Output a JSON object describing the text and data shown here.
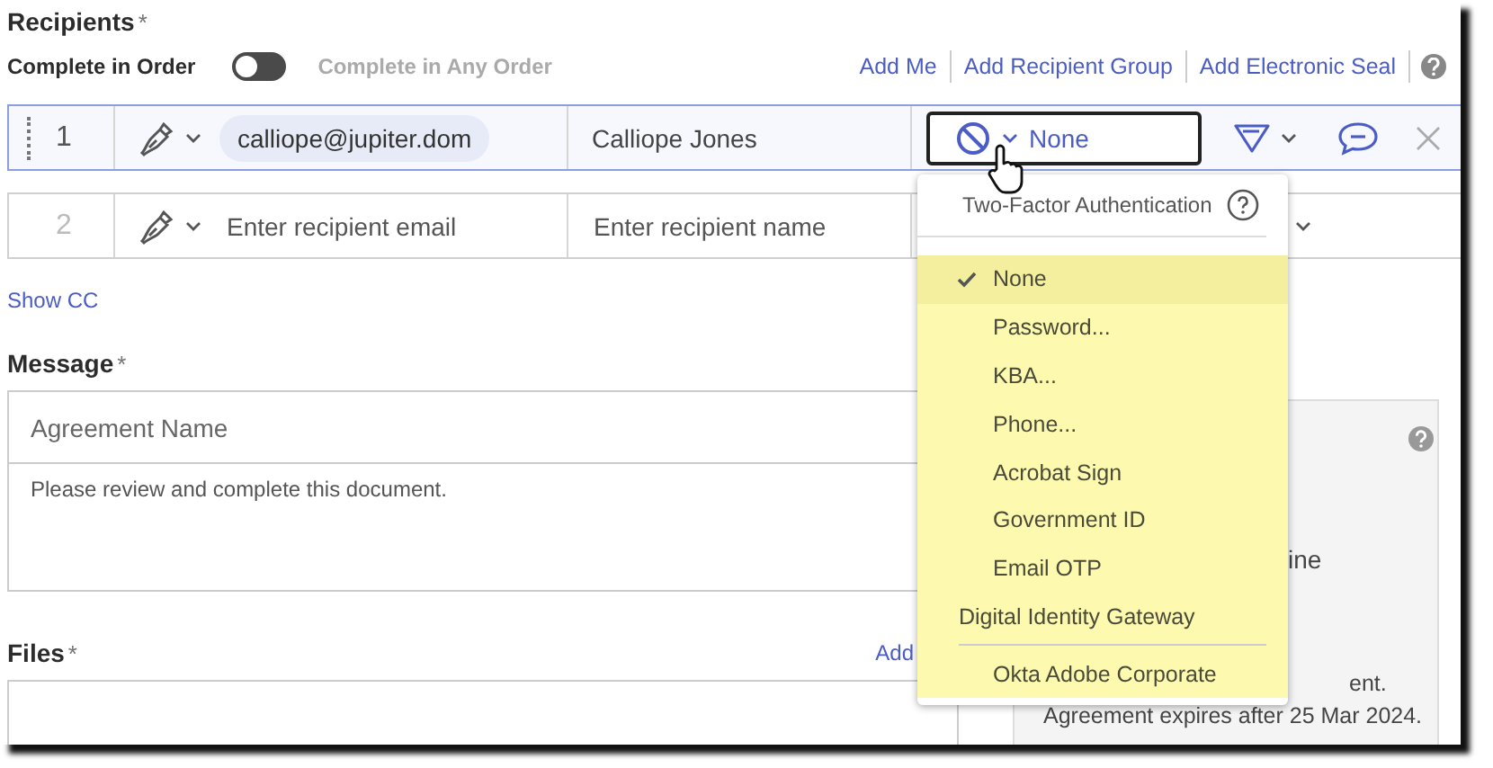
{
  "section_title": "Recipients",
  "required_mark": "*",
  "order_toggle": {
    "label_left": "Complete in Order",
    "on": false,
    "label_right": "Complete in Any Order"
  },
  "actions": [
    "Add Me",
    "Add Recipient Group",
    "Add Electronic Seal"
  ],
  "recipients": [
    {
      "number": "1",
      "email": "calliope@jupiter.dom",
      "name": "Calliope Jones",
      "active": true,
      "auth": "None"
    },
    {
      "number": "2",
      "email_placeholder": "Enter recipient email",
      "name_placeholder": "Enter recipient name",
      "active": false
    }
  ],
  "show_cc": "Show CC",
  "message": {
    "title": "Message",
    "required_mark": "*",
    "name_placeholder": "Agreement Name",
    "body": "Please review and complete this document."
  },
  "files": {
    "title": "Files",
    "required_mark": "*",
    "add_link": "Add"
  },
  "options_panel": {
    "texts": [
      "ine",
      "ent.",
      "Agreement expires after 25 Mar 2024."
    ]
  },
  "auth_menu": {
    "title": "Two-Factor Authentication",
    "items": [
      {
        "label": "None",
        "kind": "option",
        "selected": true
      },
      {
        "label": "Password...",
        "kind": "option",
        "selected": false
      },
      {
        "label": "KBA...",
        "kind": "option",
        "selected": false
      },
      {
        "label": "Phone...",
        "kind": "option",
        "selected": false
      },
      {
        "label": "Acrobat Sign",
        "kind": "option",
        "selected": false
      },
      {
        "label": "Government ID",
        "kind": "option",
        "selected": false
      },
      {
        "label": "Email OTP",
        "kind": "option",
        "selected": false
      },
      {
        "label": "Digital Identity Gateway",
        "kind": "group",
        "selected": false
      },
      {
        "label": "Okta Adobe Corporate",
        "kind": "option",
        "selected": false
      }
    ]
  }
}
